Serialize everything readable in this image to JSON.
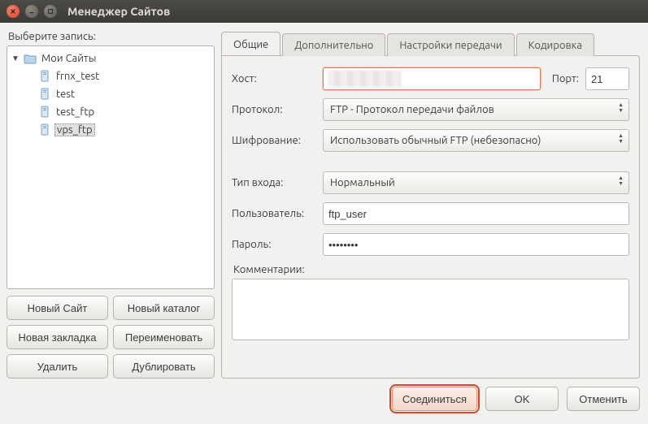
{
  "window": {
    "title": "Менеджер Сайтов"
  },
  "left": {
    "select_label": "Выберите запись:",
    "root": "Мои Сайты",
    "items": [
      {
        "label": "frnx_test"
      },
      {
        "label": "test"
      },
      {
        "label": "test_ftp"
      },
      {
        "label": "vps_ftp"
      }
    ],
    "buttons": {
      "new_site": "Новый Сайт",
      "new_folder": "Новый каталог",
      "new_bookmark": "Новая закладка",
      "rename": "Переименовать",
      "delete": "Удалить",
      "duplicate": "Дублировать"
    }
  },
  "tabs": {
    "general": "Общие",
    "advanced": "Дополнительно",
    "transfer": "Настройки передачи",
    "charset": "Кодировка"
  },
  "form": {
    "host_label": "Хост:",
    "host_value": "",
    "port_label": "Порт:",
    "port_value": "21",
    "protocol_label": "Протокол:",
    "protocol_value": "FTP - Протокол передачи файлов",
    "encryption_label": "Шифрование:",
    "encryption_value": "Использовать обычный FTP (небезопасно)",
    "logon_label": "Тип входа:",
    "logon_value": "Нормальный",
    "user_label": "Пользователь:",
    "user_value": "ftp_user",
    "password_label": "Пароль:",
    "password_value": "••••••••",
    "comments_label": "Комментарии:",
    "comments_value": ""
  },
  "bottom": {
    "connect": "Соединиться",
    "ok": "OK",
    "cancel": "Отменить"
  }
}
